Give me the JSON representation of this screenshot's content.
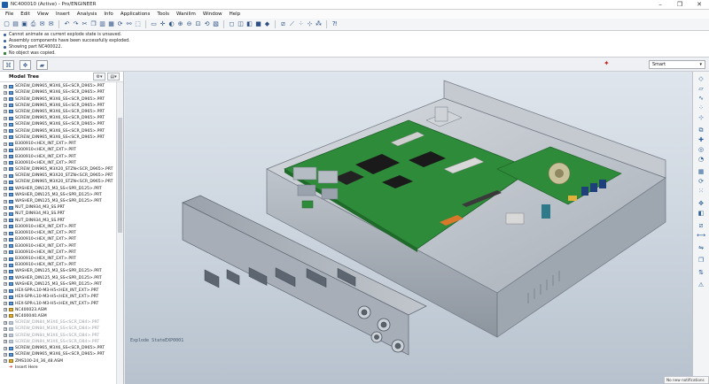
{
  "window": {
    "title": "NC400010 (Active) - Pro/ENGINEER",
    "controls": [
      "–",
      "❐",
      "✕"
    ]
  },
  "menu": [
    "File",
    "Edit",
    "View",
    "Insert",
    "Analysis",
    "Info",
    "Applications",
    "Tools",
    "Wanilim",
    "Window",
    "Help"
  ],
  "messages": [
    "Cannot animate as current explode state is unsaved.",
    "Assembly components have been successfully exploded.",
    "Showing part NC400022.",
    "No object was copied."
  ],
  "filter": {
    "value": "Smart",
    "arrow": "▾"
  },
  "tree": {
    "title": "Model Tree",
    "settings_label": "⚙▾",
    "show_label": "▤▾",
    "items": [
      {
        "label": "SCREW_DIN965_M3X6_SS<SCR_D965>.PRT",
        "kind": "part",
        "dim": false
      },
      {
        "label": "SCREW_DIN965_M3X6_SS<SCR_D965>.PRT",
        "kind": "part",
        "dim": false
      },
      {
        "label": "SCREW_DIN965_M3X6_SS<SCR_D965>.PRT",
        "kind": "part",
        "dim": false
      },
      {
        "label": "SCREW_DIN965_M3X6_SS<SCR_D965>.PRT",
        "kind": "part",
        "dim": false
      },
      {
        "label": "SCREW_DIN965_M3X6_SS<SCR_D965>.PRT",
        "kind": "part",
        "dim": false
      },
      {
        "label": "SCREW_DIN965_M3X6_SS<SCR_D965>.PRT",
        "kind": "part",
        "dim": false
      },
      {
        "label": "SCREW_DIN965_M3X6_SS<SCR_D965>.PRT",
        "kind": "part",
        "dim": false
      },
      {
        "label": "SCREW_DIN965_M3X6_SS<SCR_D965>.PRT",
        "kind": "part",
        "dim": false
      },
      {
        "label": "SCREW_DIN965_M3X6_SS<SCR_D965>.PRT",
        "kind": "part",
        "dim": false
      },
      {
        "label": "B300910<HEX_INT_EXT>.PRT",
        "kind": "part",
        "dim": false
      },
      {
        "label": "B300910<HEX_INT_EXT>.PRT",
        "kind": "part",
        "dim": false
      },
      {
        "label": "B300910<HEX_INT_EXT>.PRT",
        "kind": "part",
        "dim": false
      },
      {
        "label": "B300910<HEX_INT_EXT>.PRT",
        "kind": "part",
        "dim": false
      },
      {
        "label": "SCREW_DIN965_M3X20_STZN<SCR_D965>.PRT",
        "kind": "part",
        "dim": false
      },
      {
        "label": "SCREW_DIN965_M3X20_STZN<SCR_D965>.PRT",
        "kind": "part",
        "dim": false
      },
      {
        "label": "SCREW_DIN965_M3X20_STZN<SCR_D965>.PRT",
        "kind": "part",
        "dim": false
      },
      {
        "label": "WASHER_DIN125_M3_SS<SPR_D125>.PRT",
        "kind": "part",
        "dim": false
      },
      {
        "label": "WASHER_DIN125_M3_SS<SPR_D125>.PRT",
        "kind": "part",
        "dim": false
      },
      {
        "label": "WASHER_DIN125_M3_SS<SPR_D125>.PRT",
        "kind": "part",
        "dim": false
      },
      {
        "label": "NUT_DIN934_M3_SS.PRT",
        "kind": "part",
        "dim": false
      },
      {
        "label": "NUT_DIN934_M3_SS.PRT",
        "kind": "part",
        "dim": false
      },
      {
        "label": "NUT_DIN934_M3_SS.PRT",
        "kind": "part",
        "dim": false
      },
      {
        "label": "B300910<HEX_INT_EXT>.PRT",
        "kind": "part",
        "dim": false
      },
      {
        "label": "B300910<HEX_INT_EXT>.PRT",
        "kind": "part",
        "dim": false
      },
      {
        "label": "B300910<HEX_INT_EXT>.PRT",
        "kind": "part",
        "dim": false
      },
      {
        "label": "B300910<HEX_INT_EXT>.PRT",
        "kind": "part",
        "dim": false
      },
      {
        "label": "B300910<HEX_INT_EXT>.PRT",
        "kind": "part",
        "dim": false
      },
      {
        "label": "B300910<HEX_INT_EXT>.PRT",
        "kind": "part",
        "dim": false
      },
      {
        "label": "B300910<HEX_INT_EXT>.PRT",
        "kind": "part",
        "dim": false
      },
      {
        "label": "WASHER_DIN125_M3_SS<SPR_D125>.PRT",
        "kind": "part",
        "dim": false
      },
      {
        "label": "WASHER_DIN125_M3_SS<SPR_D125>.PRT",
        "kind": "part",
        "dim": false
      },
      {
        "label": "WASHER_DIN125_M3_SS<SPR_D125>.PRT",
        "kind": "part",
        "dim": false
      },
      {
        "label": "HEX-SPR-L10-M3-H5<HEX_INT_EXT>.PRT",
        "kind": "part",
        "dim": false
      },
      {
        "label": "HEX-SPR-L10-M3-H5<HEX_INT_EXT>.PRT",
        "kind": "part",
        "dim": false
      },
      {
        "label": "HEX-SPR-L10-M3-H5<HEX_INT_EXT>.PRT",
        "kind": "part",
        "dim": false
      },
      {
        "label": "NC400023.ASM",
        "kind": "asm",
        "dim": false
      },
      {
        "label": "NC400040.ASM",
        "kind": "asm",
        "dim": false
      },
      {
        "label": "SCREW_DIN84_M3X6_SS<SCR_D84>.PRT",
        "kind": "part",
        "dim": true
      },
      {
        "label": "SCREW_DIN84_M3X6_SS<SCR_D84>.PRT",
        "kind": "part",
        "dim": true
      },
      {
        "label": "SCREW_DIN84_M3X6_SS<SCR_D84>.PRT",
        "kind": "part",
        "dim": true
      },
      {
        "label": "SCREW_DIN84_M3X6_SS<SCR_D84>.PRT",
        "kind": "part",
        "dim": true
      },
      {
        "label": "SCREW_DIN965_M3X6_SS<SCR_D965>.PRT",
        "kind": "part",
        "dim": false
      },
      {
        "label": "SCREW_DIN965_M3X6_SS<SCR_D965>.PRT",
        "kind": "part",
        "dim": false
      },
      {
        "label": "ZMS100-24_36_48.ASM",
        "kind": "asm",
        "dim": false
      },
      {
        "label": "Insert Here",
        "kind": "insert",
        "dim": false
      }
    ]
  },
  "viewport": {
    "explode_state": "Explode StateEXP0001"
  },
  "status": {
    "notifications": "No new notifications"
  },
  "colors": {
    "pcb": "#2e8b3a",
    "chassis": "#c8ccd2",
    "accent": "#1f5fa8"
  }
}
